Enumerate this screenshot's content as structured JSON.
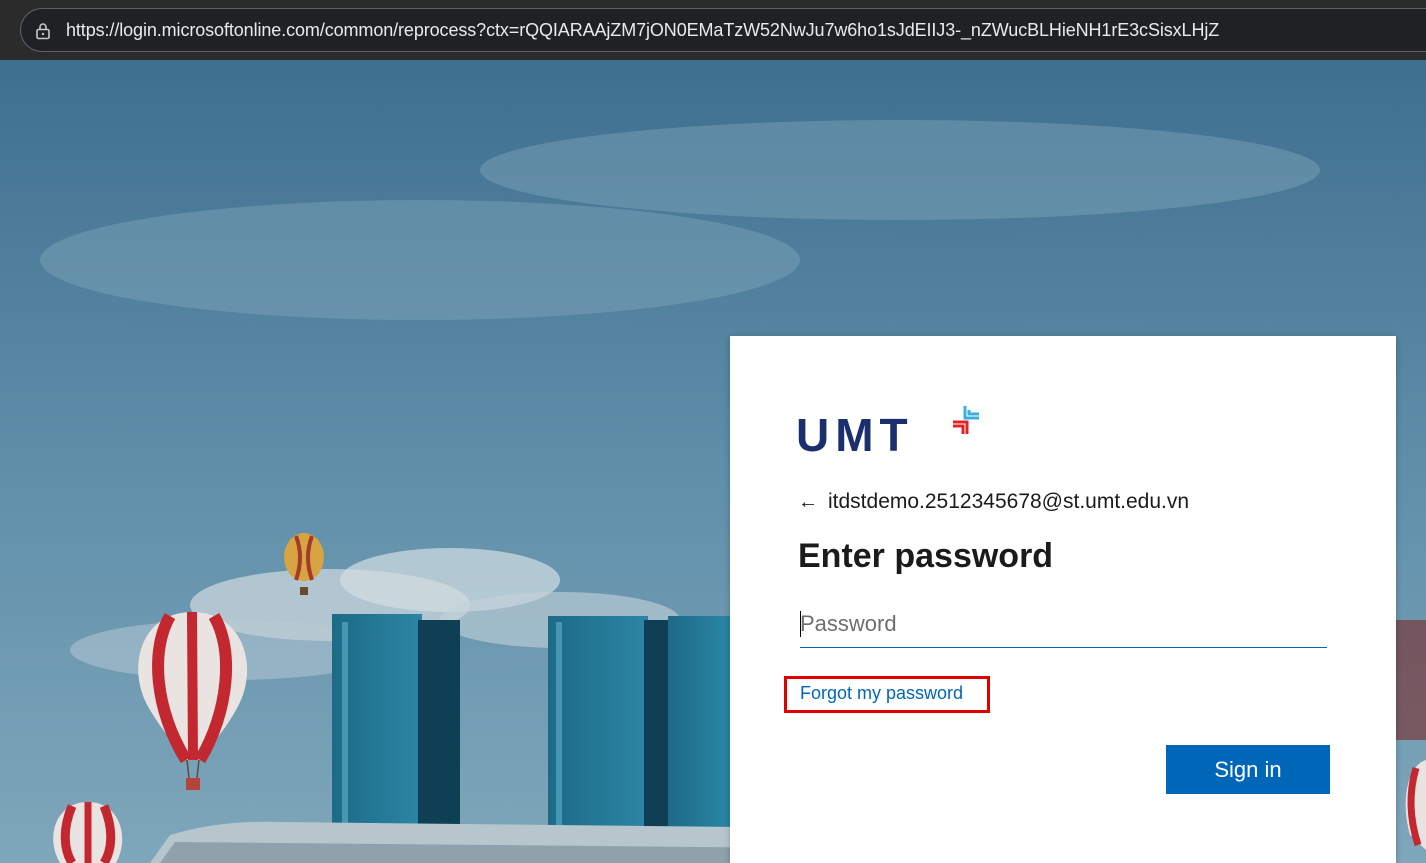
{
  "browser": {
    "url": "https://login.microsoftonline.com/common/reprocess?ctx=rQQIARAAjZM7jON0EMaTzW52NwJu7w6ho1sJdEIIJ3-_nZWucBLHieNH1rE3cSisxLHjZ",
    "lock_icon": "lock-icon"
  },
  "card": {
    "logo_text": "UMT",
    "logo_mark_colors": [
      "#3ab0e0",
      "#e0252a"
    ],
    "back_icon": "back-arrow-icon",
    "back_arrow": "←",
    "identity": "itdstdemo.2512345678@st.umt.edu.vn",
    "title": "Enter password",
    "password_placeholder": "Password",
    "password_value": "",
    "forgot_label": "Forgot my password",
    "signin_label": "Sign in"
  },
  "colors": {
    "accent": "#0067b8",
    "highlight_border": "#e00000",
    "logo": "#1b2f6e"
  }
}
